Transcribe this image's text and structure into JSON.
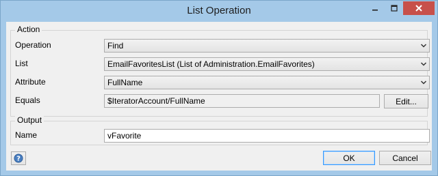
{
  "window": {
    "title": "List Operation"
  },
  "system_buttons": {
    "minimize_icon": "minimize-icon",
    "maximize_icon": "maximize-icon",
    "close_icon": "close-icon",
    "close_color": "#c7504a"
  },
  "action": {
    "legend": "Action",
    "operation": {
      "label": "Operation",
      "value": "Find"
    },
    "list": {
      "label": "List",
      "value": "EmailFavoritesList (List of Administration.EmailFavorites)"
    },
    "attribute": {
      "label": "Attribute",
      "value": "FullName"
    },
    "equals": {
      "label": "Equals",
      "value": "$IteratorAccount/FullName",
      "edit_label": "Edit..."
    }
  },
  "output": {
    "legend": "Output",
    "name": {
      "label": "Name",
      "value": "vFavorite"
    }
  },
  "footer": {
    "help_icon": "help-icon",
    "ok_label": "OK",
    "cancel_label": "Cancel",
    "accent": "#3399ff"
  }
}
